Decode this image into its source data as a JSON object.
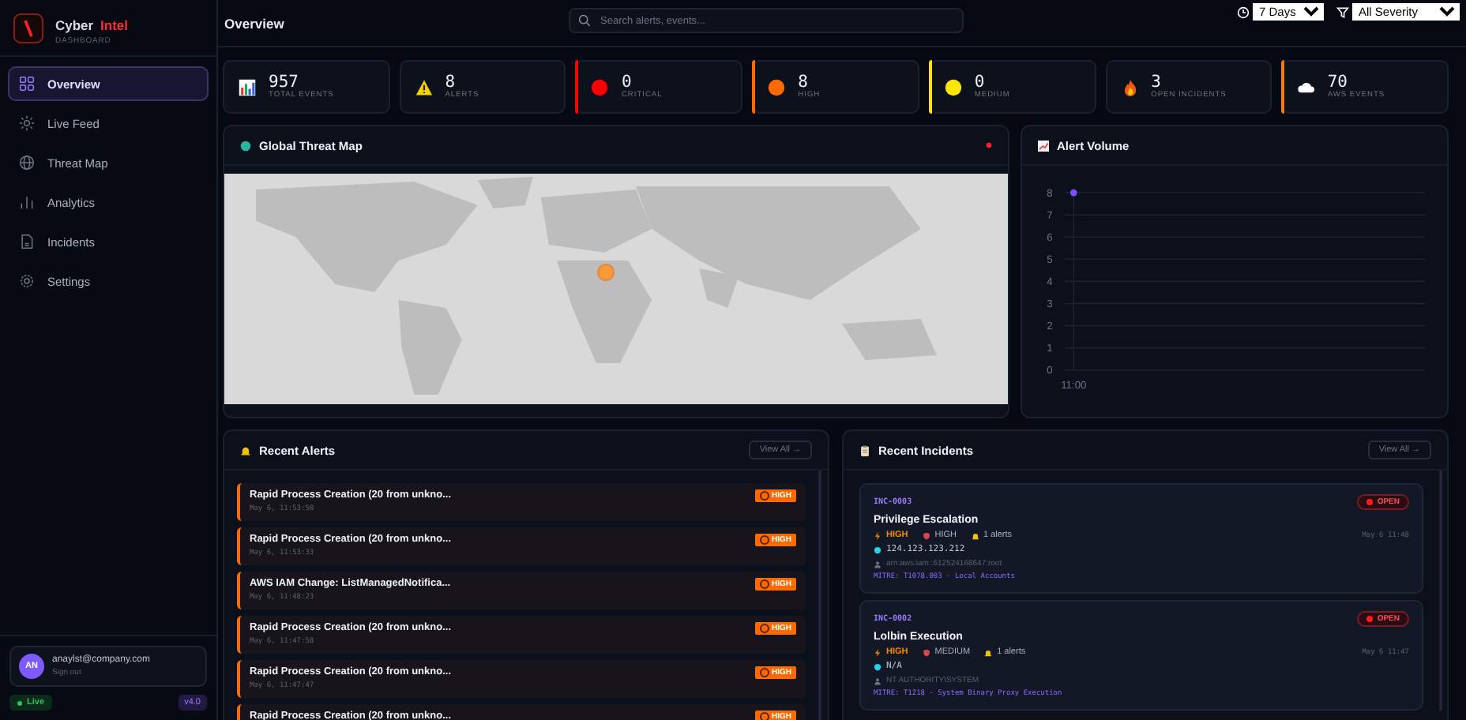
{
  "brand": {
    "name": "Cyber",
    "accent": "Intel",
    "subtitle": "DASHBOARD"
  },
  "sidebar": {
    "items": [
      {
        "label": "Overview",
        "selected": true
      },
      {
        "label": "Live Feed",
        "selected": false
      },
      {
        "label": "Threat Map",
        "selected": false
      },
      {
        "label": "Analytics",
        "selected": false
      },
      {
        "label": "Incidents",
        "selected": false
      },
      {
        "label": "Settings",
        "selected": false
      }
    ],
    "user": {
      "initials": "AN",
      "email": "anaylst@company.com",
      "action": "Sign out"
    },
    "status": "Live",
    "version": "v4.0"
  },
  "header": {
    "title": "Overview",
    "search": {
      "placeholder": "Search alerts, events..."
    },
    "range": "7 Days",
    "severity": "All Severity"
  },
  "stats": [
    {
      "value": "957",
      "label": "TOTAL EVENTS",
      "kind": "chart"
    },
    {
      "value": "8",
      "label": "ALERTS",
      "kind": "warning"
    },
    {
      "value": "0",
      "label": "CRITICAL",
      "kind": "dot",
      "color": "#ff0000"
    },
    {
      "value": "8",
      "label": "HIGH",
      "kind": "dot",
      "color": "#ff6a00"
    },
    {
      "value": "0",
      "label": "MEDIUM",
      "kind": "dot",
      "color": "#ffe600"
    },
    {
      "value": "3",
      "label": "OPEN INCIDENTS",
      "kind": "fire"
    },
    {
      "value": "70",
      "label": "AWS EVENTS",
      "kind": "cloud",
      "color": "#f27a1a"
    }
  ],
  "threat_map": {
    "title": "Global Threat Map"
  },
  "alert_volume": {
    "title": "Alert Volume",
    "chart_data": {
      "type": "line",
      "categories": [
        "11:00"
      ],
      "series": [
        {
          "color": "#7c4dff",
          "marker": true,
          "values": [
            8
          ]
        }
      ],
      "grid": true,
      "ylim": [
        0,
        8
      ],
      "yticks": [
        0,
        1,
        2,
        3,
        4,
        5,
        6,
        7,
        8
      ]
    }
  },
  "recent_alerts": {
    "title": "Recent Alerts",
    "action": "View All →",
    "items": [
      {
        "title": "Rapid Process Creation (20 from unkno...",
        "time": "May 6, 11:53:50",
        "severity": "HIGH",
        "kind": "high"
      },
      {
        "title": "Rapid Process Creation (20 from unkno...",
        "time": "May 6, 11:53:33",
        "severity": "HIGH",
        "kind": "high"
      },
      {
        "title": "AWS IAM Change: ListManagedNotifica...",
        "time": "May 6, 11:48:23",
        "severity": "HIGH",
        "kind": "high"
      },
      {
        "title": "Rapid Process Creation (20 from unkno...",
        "time": "May 6, 11:47:58",
        "severity": "HIGH",
        "kind": "high"
      },
      {
        "title": "Rapid Process Creation (20 from unkno...",
        "time": "May 6, 11:47:47",
        "severity": "HIGH",
        "kind": "high"
      },
      {
        "title": "Rapid Process Creation (20 from unkno...",
        "severity": "HIGH",
        "kind": "high"
      }
    ]
  },
  "recent_incidents": {
    "title": "Recent Incidents",
    "action": "View All →",
    "items": [
      {
        "id": "INC-0003",
        "title": "Privilege Escalation",
        "status": "OPEN",
        "priority": "HIGH",
        "severity": "HIGH",
        "alerts": "1 alerts",
        "ip": "124.123.123.212",
        "user": "arn:aws:iam::612524168647:root",
        "mitre": "MITRE: T1078.003 - Local Accounts",
        "time": "May 6 11:48"
      },
      {
        "id": "INC-0002",
        "title": "Lolbin Execution",
        "status": "OPEN",
        "priority": "HIGH",
        "severity": "MEDIUM",
        "alerts": "1 alerts",
        "ip": "N/A",
        "user": "NT AUTHORITY\\SYSTEM",
        "mitre": "MITRE: T1218 - System Binary Proxy Execution",
        "time": "May 6 11:47"
      }
    ]
  }
}
